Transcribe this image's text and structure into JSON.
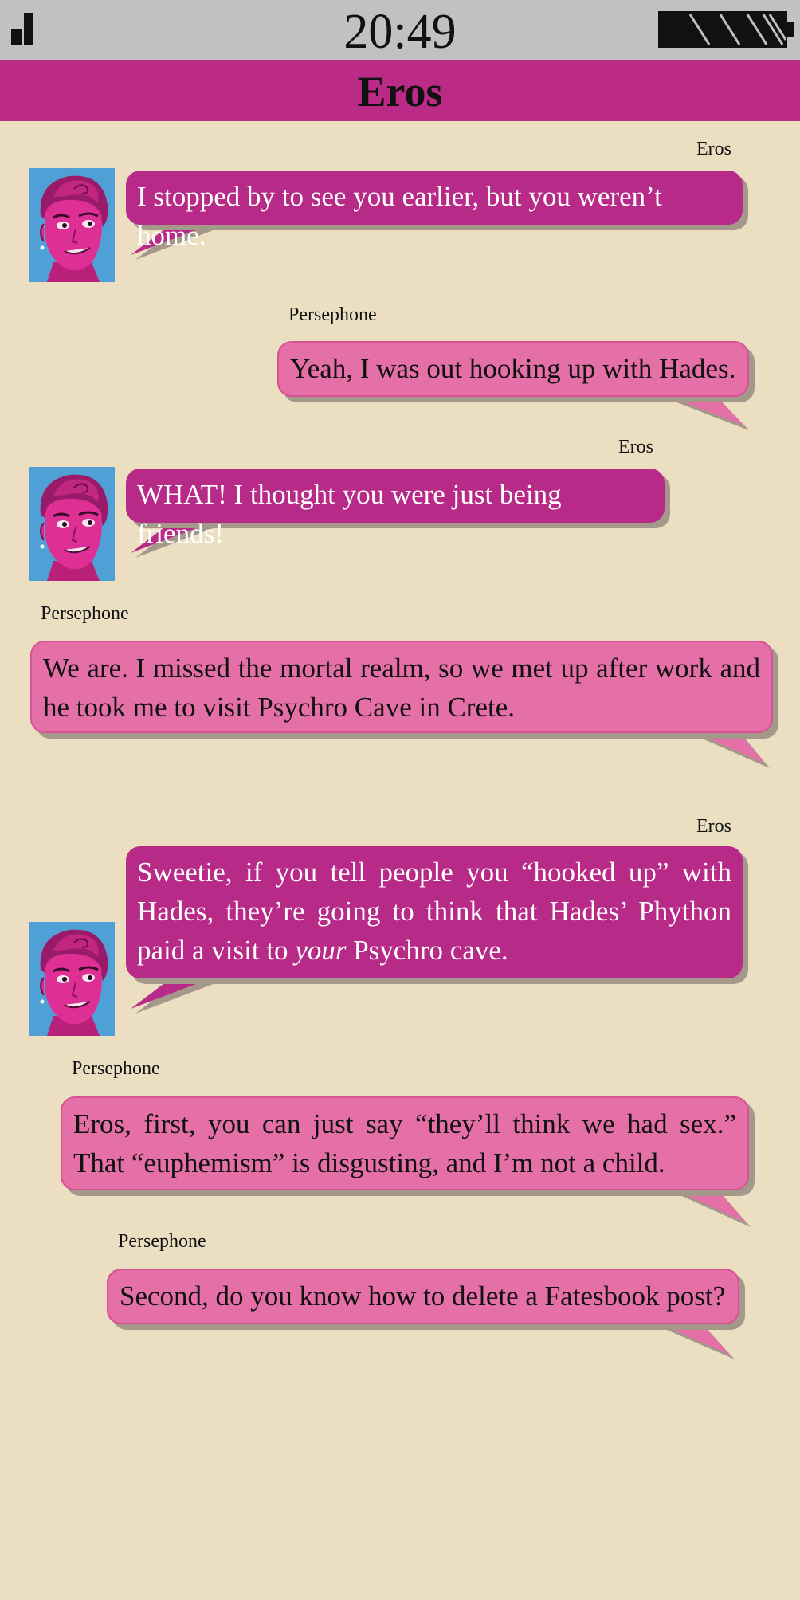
{
  "status_bar": {
    "time": "20:49"
  },
  "header": {
    "title": "Eros"
  },
  "colors": {
    "background": "#ecdfc1",
    "status_bar": "#c1c1c1",
    "header": "#bc2a88",
    "eros_bubble": "#b82a88",
    "persephone_bubble": "#e56fa7"
  },
  "messages": [
    {
      "sender": "Eros",
      "text": "I stopped by to see you earlier, but you weren’t home."
    },
    {
      "sender": "Persephone",
      "text": "Yeah, I was out hooking up with Hades."
    },
    {
      "sender": "Eros",
      "text": "WHAT! I thought you were just being friends!"
    },
    {
      "sender": "Persephone",
      "text": "We are. I missed the mortal realm, so we met up after work and he took me to visit Psychro Cave in Crete."
    },
    {
      "sender": "Eros",
      "text_before": "Sweetie, if you tell people you “hooked up” with Hades, they’re going to think that Hades’ Phython paid a visit to ",
      "text_emphasis": "your",
      "text_after": " Psychro cave."
    },
    {
      "sender": "Persephone",
      "text": "Eros, first, you can just say “they’ll think we had sex.” That “euphemism” is disgusting, and I’m not a child."
    },
    {
      "sender": "Persephone",
      "text": "Second, do you know how to delete a Fatesbook post?"
    }
  ]
}
